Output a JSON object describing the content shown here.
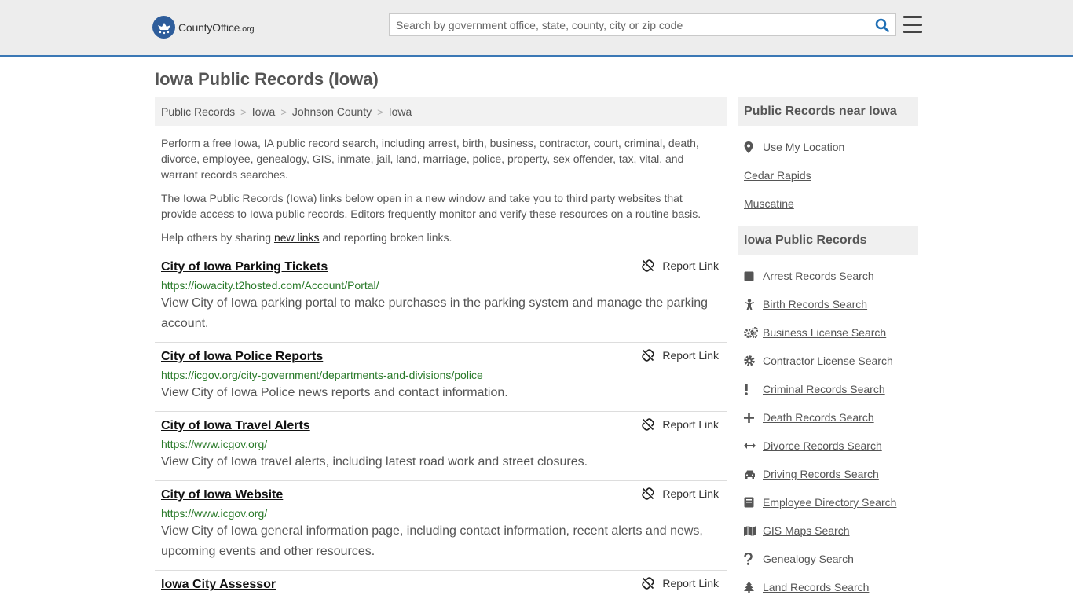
{
  "header": {
    "logo_text": "CountyOffice",
    "logo_tld": ".org",
    "search_placeholder": "Search by government office, state, county, city or zip code"
  },
  "page_title": "Iowa Public Records (Iowa)",
  "breadcrumb": [
    "Public Records",
    "Iowa",
    "Johnson County",
    "Iowa"
  ],
  "intro": {
    "p1": "Perform a free Iowa, IA public record search, including arrest, birth, business, contractor, court, criminal, death, divorce, employee, genealogy, GIS, inmate, jail, land, marriage, police, property, sex offender, tax, vital, and warrant records searches.",
    "p2": "The Iowa Public Records (Iowa) links below open in a new window and take you to third party websites that provide access to Iowa public records. Editors frequently monitor and verify these resources on a routine basis.",
    "p3_before": "Help others by sharing ",
    "p3_link": "new links",
    "p3_after": " and reporting broken links."
  },
  "report_label": "Report Link",
  "records": [
    {
      "title": "City of Iowa Parking Tickets",
      "url": "https://iowacity.t2hosted.com/Account/Portal/",
      "desc": "View City of Iowa parking portal to make purchases in the parking system and manage the parking account."
    },
    {
      "title": "City of Iowa Police Reports",
      "url": "https://icgov.org/city-government/departments-and-divisions/police",
      "desc": "View City of Iowa Police news reports and contact information."
    },
    {
      "title": "City of Iowa Travel Alerts",
      "url": "https://www.icgov.org/",
      "desc": "View City of Iowa travel alerts, including latest road work and street closures."
    },
    {
      "title": "City of Iowa Website",
      "url": "https://www.icgov.org/",
      "desc": "View City of Iowa general information page, including contact information, recent alerts and news, upcoming events and other resources."
    },
    {
      "title": "Iowa City Assessor",
      "url": "",
      "desc": ""
    }
  ],
  "sidebar": {
    "near_title": "Public Records near Iowa",
    "near_items": [
      {
        "label": "Use My Location",
        "icon": "location-pin-icon"
      },
      {
        "label": "Cedar Rapids",
        "icon": ""
      },
      {
        "label": "Muscatine",
        "icon": ""
      }
    ],
    "records_title": "Iowa Public Records",
    "record_items": [
      {
        "label": "Arrest Records Search",
        "icon": "square-icon"
      },
      {
        "label": "Birth Records Search",
        "icon": "baby-icon"
      },
      {
        "label": "Business License Search",
        "icon": "gears-icon"
      },
      {
        "label": "Contractor License Search",
        "icon": "gear-icon"
      },
      {
        "label": "Criminal Records Search",
        "icon": "exclamation-icon"
      },
      {
        "label": "Death Records Search",
        "icon": "plus-icon"
      },
      {
        "label": "Divorce Records Search",
        "icon": "arrows-horizontal-icon"
      },
      {
        "label": "Driving Records Search",
        "icon": "car-icon"
      },
      {
        "label": "Employee Directory Search",
        "icon": "book-icon"
      },
      {
        "label": "GIS Maps Search",
        "icon": "map-icon"
      },
      {
        "label": "Genealogy Search",
        "icon": "question-icon"
      },
      {
        "label": "Land Records Search",
        "icon": "tree-icon"
      }
    ]
  },
  "colors": {
    "header_bg": "#ededed",
    "header_border": "#3b78b5",
    "link_green": "#2a7a2a",
    "search_icon": "#1f6fb5"
  }
}
